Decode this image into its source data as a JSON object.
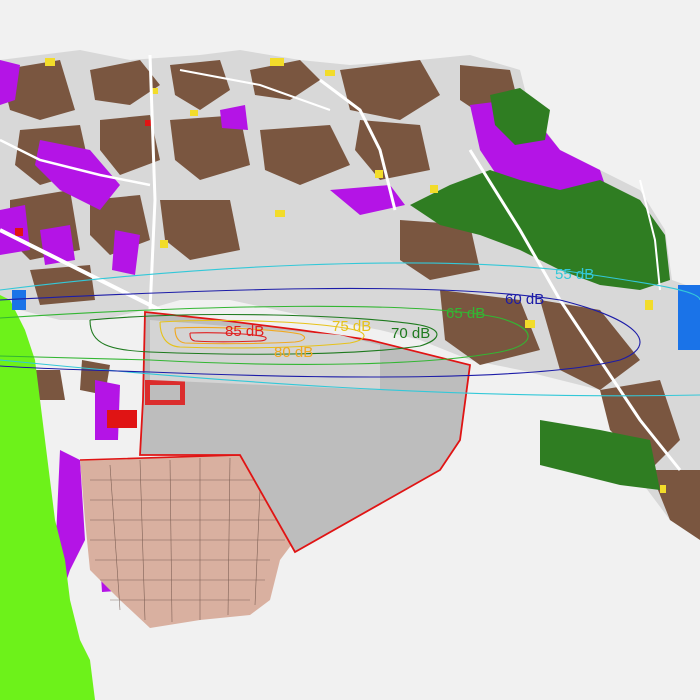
{
  "map": {
    "noise_contours": [
      {
        "label": "55 dB",
        "color": "#33c8d8"
      },
      {
        "label": "60 dB",
        "color": "#1c1ca8"
      },
      {
        "label": "65 dB",
        "color": "#33b633"
      },
      {
        "label": "70 dB",
        "color": "#1e7a1e"
      },
      {
        "label": "75 dB",
        "color": "#e6c21a"
      },
      {
        "label": "80 dB",
        "color": "#f0a820"
      },
      {
        "label": "85 dB",
        "color": "#e02020"
      }
    ],
    "colors": {
      "background": "#f1f1f1",
      "residential_brown": "#7a5640",
      "commercial_purple": "#b414e6",
      "green_forest": "#2f7d22",
      "green_bright": "#6df21a",
      "water_blue": "#1a73e8",
      "settlement_pink": "#d9b0a0",
      "airport_grey": "#bdbdbd",
      "airport_boundary": "#e01414",
      "yellow_parcels": "#f2dc2a"
    }
  }
}
